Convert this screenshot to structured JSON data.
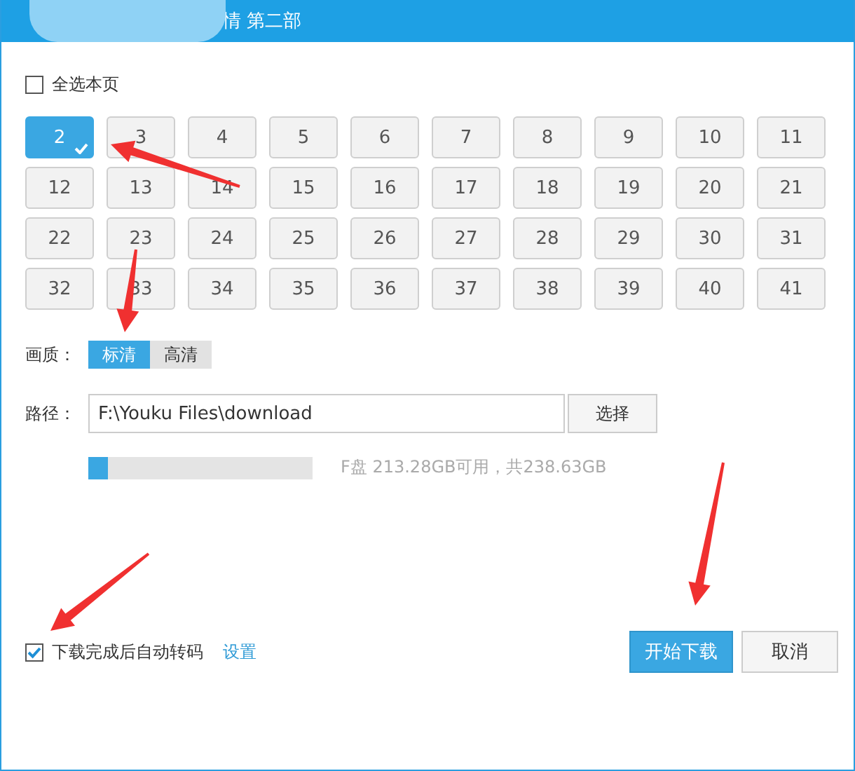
{
  "window": {
    "title": "情 第二部"
  },
  "select_all": {
    "label": "全选本页",
    "checked": false
  },
  "episodes": [
    {
      "label": "2",
      "selected": true
    },
    {
      "label": "3",
      "selected": false
    },
    {
      "label": "4",
      "selected": false
    },
    {
      "label": "5",
      "selected": false
    },
    {
      "label": "6",
      "selected": false
    },
    {
      "label": "7",
      "selected": false
    },
    {
      "label": "8",
      "selected": false
    },
    {
      "label": "9",
      "selected": false
    },
    {
      "label": "10",
      "selected": false
    },
    {
      "label": "11",
      "selected": false
    },
    {
      "label": "12",
      "selected": false
    },
    {
      "label": "13",
      "selected": false
    },
    {
      "label": "14",
      "selected": false
    },
    {
      "label": "15",
      "selected": false
    },
    {
      "label": "16",
      "selected": false
    },
    {
      "label": "17",
      "selected": false
    },
    {
      "label": "18",
      "selected": false
    },
    {
      "label": "19",
      "selected": false
    },
    {
      "label": "20",
      "selected": false
    },
    {
      "label": "21",
      "selected": false
    },
    {
      "label": "22",
      "selected": false
    },
    {
      "label": "23",
      "selected": false
    },
    {
      "label": "24",
      "selected": false
    },
    {
      "label": "25",
      "selected": false
    },
    {
      "label": "26",
      "selected": false
    },
    {
      "label": "27",
      "selected": false
    },
    {
      "label": "28",
      "selected": false
    },
    {
      "label": "29",
      "selected": false
    },
    {
      "label": "30",
      "selected": false
    },
    {
      "label": "31",
      "selected": false
    },
    {
      "label": "32",
      "selected": false
    },
    {
      "label": "33",
      "selected": false
    },
    {
      "label": "34",
      "selected": false
    },
    {
      "label": "35",
      "selected": false
    },
    {
      "label": "36",
      "selected": false
    },
    {
      "label": "37",
      "selected": false
    },
    {
      "label": "38",
      "selected": false
    },
    {
      "label": "39",
      "selected": false
    },
    {
      "label": "40",
      "selected": false
    },
    {
      "label": "41",
      "selected": false
    }
  ],
  "quality": {
    "label": "画质：",
    "options": [
      {
        "label": "标清",
        "selected": true
      },
      {
        "label": "高清",
        "selected": false
      }
    ]
  },
  "path": {
    "label": "路径：",
    "value": "F:\\Youku Files\\download",
    "button": "选择"
  },
  "disk": {
    "level": 0.09,
    "reading": "F盘 213.28GB可用，共238.63GB"
  },
  "auto_convert": {
    "label": "下载完成后自动转码",
    "checked": true,
    "link": "设置"
  },
  "buttons": [
    {
      "label": "开始下载",
      "kind": "primary"
    },
    {
      "label": "取消",
      "kind": "secondary"
    }
  ]
}
